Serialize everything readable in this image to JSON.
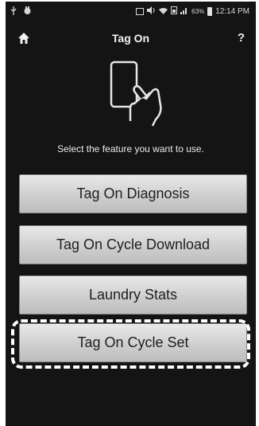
{
  "status_bar": {
    "battery": "63%",
    "time": "12:14 PM"
  },
  "header": {
    "title": "Tag On",
    "help_label": "?"
  },
  "prompt": "Select the feature you want to use.",
  "menu": {
    "items": [
      {
        "label": "Tag On Diagnosis"
      },
      {
        "label": "Tag On Cycle Download"
      },
      {
        "label": "Laundry Stats"
      },
      {
        "label": "Tag On Cycle Set",
        "highlighted": true
      }
    ]
  },
  "icons": [
    "usb-icon",
    "notification-icon",
    "cast-icon",
    "volume-icon",
    "wifi-icon",
    "sim-icon",
    "signal-icon",
    "battery-icon",
    "home-icon",
    "phone-tap-icon"
  ]
}
